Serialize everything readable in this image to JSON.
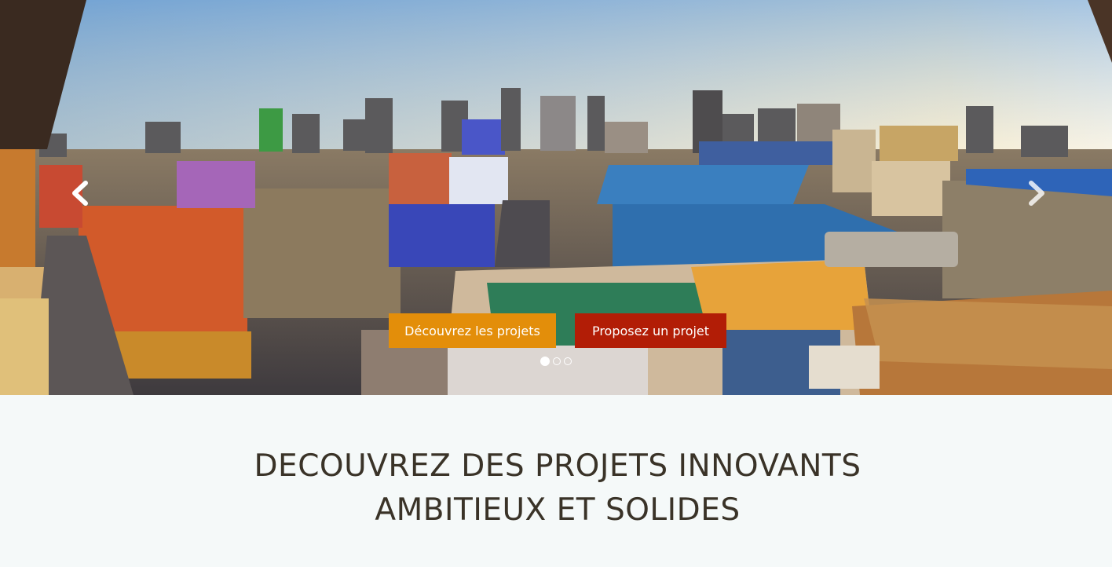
{
  "hero": {
    "prev_icon": "chevron-left-icon",
    "next_icon": "chevron-right-icon",
    "buttons": {
      "discover_label": "Découvrez les projets",
      "propose_label": "Proposez un projet"
    },
    "indicators": {
      "count": 3,
      "active": 1
    }
  },
  "colors": {
    "discover_button": "#e38e0a",
    "propose_button": "#b21d06",
    "headline_text": "#3a3328",
    "section_background": "#f5f9f9"
  },
  "headline": {
    "line1": "DECOUVREZ DES PROJETS INNOVANTS",
    "line2": "AMBITIEUX ET SOLIDES"
  }
}
